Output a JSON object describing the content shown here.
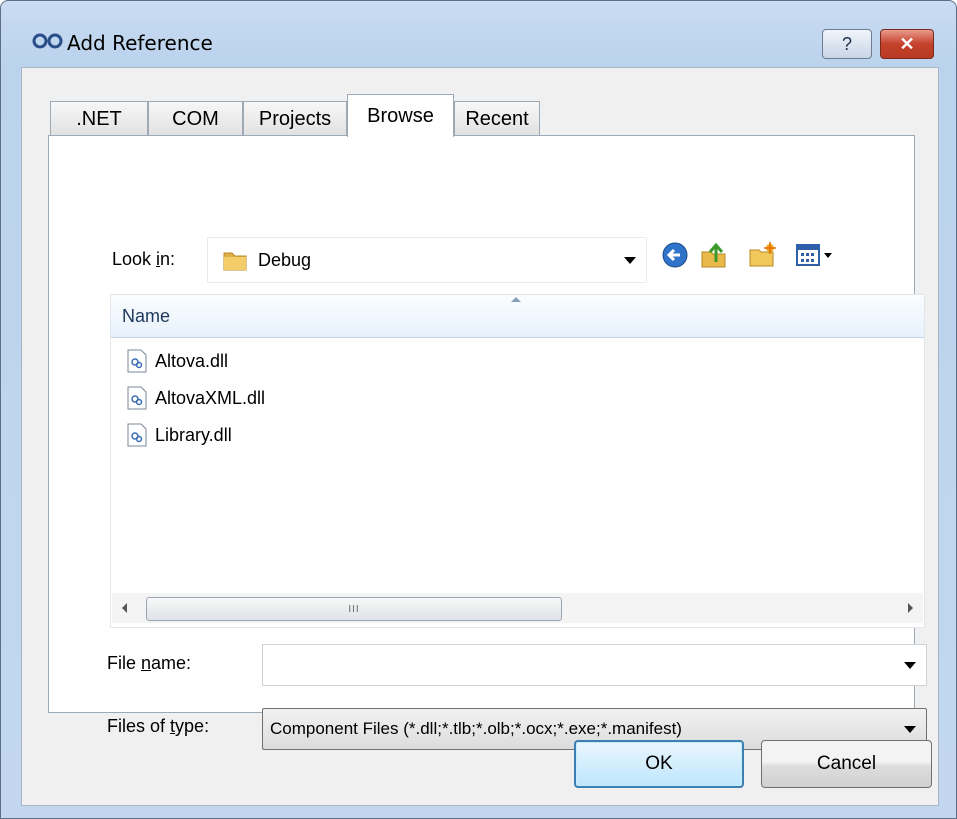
{
  "window": {
    "title": "Add Reference",
    "help_glyph": "?",
    "close_glyph": "✕"
  },
  "tabs": [
    {
      "label": ".NET",
      "active": false
    },
    {
      "label": "COM",
      "active": false
    },
    {
      "label": "Projects",
      "active": false
    },
    {
      "label": "Browse",
      "active": true
    },
    {
      "label": "Recent",
      "active": false
    }
  ],
  "look_in": {
    "label_pre": "Look ",
    "label_accel": "i",
    "label_post": "n:",
    "value": "Debug",
    "toolbar_icons": [
      "back-arrow-icon",
      "up-folder-icon",
      "new-folder-icon",
      "view-menu-icon"
    ]
  },
  "file_list": {
    "column_header": "Name",
    "files": [
      "Altova.dll",
      "AltovaXML.dll",
      "Library.dll"
    ],
    "scroll_thumb_grip": "III"
  },
  "file_name": {
    "label_pre": "File ",
    "label_accel": "n",
    "label_post": "ame:",
    "value": ""
  },
  "file_type": {
    "label_pre": "Files of ",
    "label_accel": "t",
    "label_post": "ype:",
    "value": "Component Files (*.dll;*.tlb;*.olb;*.ocx;*.exe;*.manifest)"
  },
  "buttons": {
    "ok": "OK",
    "cancel": "Cancel"
  },
  "colors": {
    "title_bar": "#bcd3ee",
    "close_button": "#c4412b",
    "ok_border": "#3c7fb1",
    "header_text": "#1e395b"
  }
}
